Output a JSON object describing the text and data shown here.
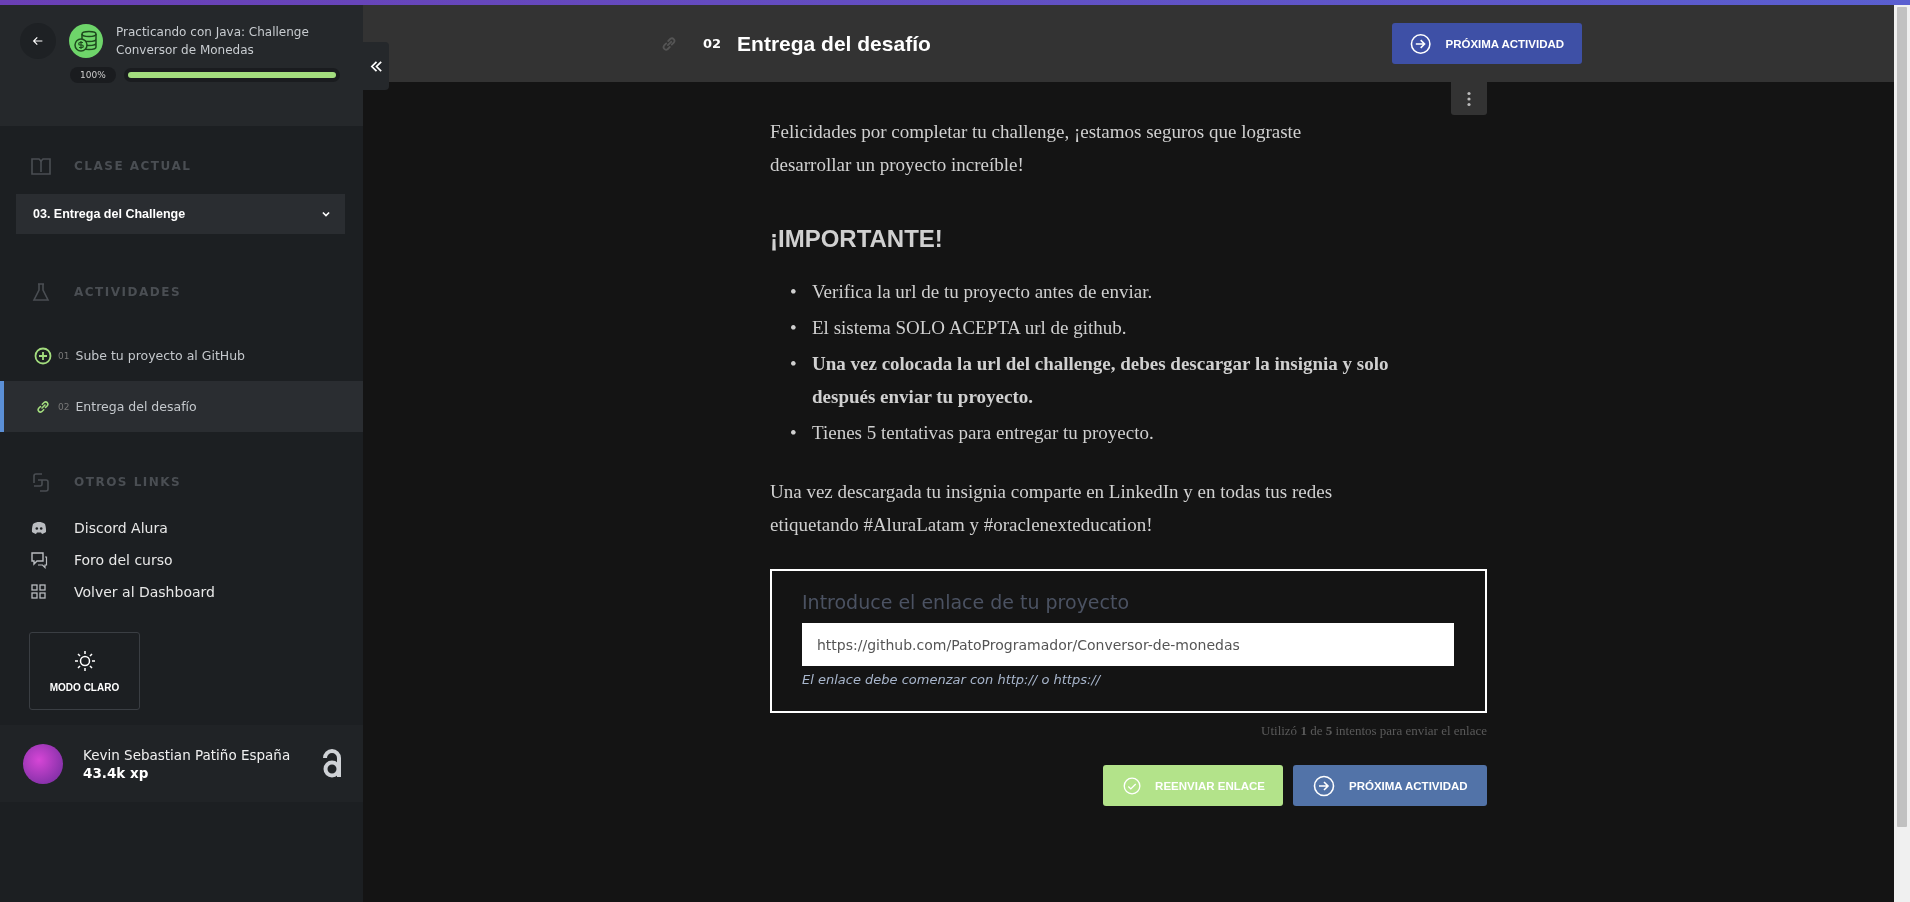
{
  "course": {
    "title": "Practicando con Java: Challenge Conversor de Monedas",
    "progress_label": "100%",
    "level": 1
  },
  "sidebar": {
    "current_class": {
      "heading": "CLASE ACTUAL",
      "value": "03. Entrega del Challenge"
    },
    "activities": {
      "heading": "ACTIVIDADES",
      "items": [
        {
          "number": "01",
          "label": "Sube tu proyecto al GitHub",
          "kind": "plus",
          "selected": false
        },
        {
          "number": "02",
          "label": "Entrega del desafío",
          "kind": "link",
          "selected": true
        }
      ]
    },
    "other_links": {
      "heading": "OTROS LINKS",
      "items": [
        {
          "label": "Discord Alura",
          "kind": "discord"
        },
        {
          "label": "Foro del curso",
          "kind": "forum"
        },
        {
          "label": "Volver al Dashboard",
          "kind": "dashboard"
        }
      ]
    },
    "theme_button": "MODO CLARO",
    "user": {
      "name": "Kevin Sebastian Patiño España",
      "xp": "43.4k xp"
    }
  },
  "header": {
    "number": "02",
    "title": "Entrega del desafío",
    "next_button": "PRÓXIMA ACTIVIDAD"
  },
  "content": {
    "intro": "Felicidades por completar tu challenge, ¡estamos seguros que lograste desarrollar un proyecto increíble!",
    "heading": "¡IMPORTANTE!",
    "bullets": [
      {
        "marker": "•",
        "text": "Verifica la url de tu proyecto antes de enviar.",
        "bold": false
      },
      {
        "marker": "•",
        "text": "El sistema SOLO ACEPTA url de github.",
        "bold": false
      },
      {
        "marker": "•",
        "text": "Una vez colocada la url del challenge, debes descargar la insignia y solo después enviar tu proyecto.",
        "bold": true
      },
      {
        "marker": "•",
        "text": "Tienes 5 tentativas para entregar tu proyecto.",
        "bold": false
      }
    ],
    "closing": "Una vez descargada tu insignia comparte en LinkedIn y en todas tus redes etiquetando #AluraLatam y #oraclenexteducation!",
    "form": {
      "label": "Introduce el enlace de tu proyecto",
      "value": "https://github.com/PatoProgramador/Conversor-de-monedas",
      "hint": "El enlace debe comenzar con http:// o https://"
    },
    "attempts": "Utilizó **1** de **5** intentos para enviar el enlace",
    "buttons": [
      {
        "label": "REENVIAR ENLACE",
        "kind": "resend"
      },
      {
        "label": "PRÓXIMA ACTIVIDAD",
        "kind": "next"
      }
    ]
  }
}
